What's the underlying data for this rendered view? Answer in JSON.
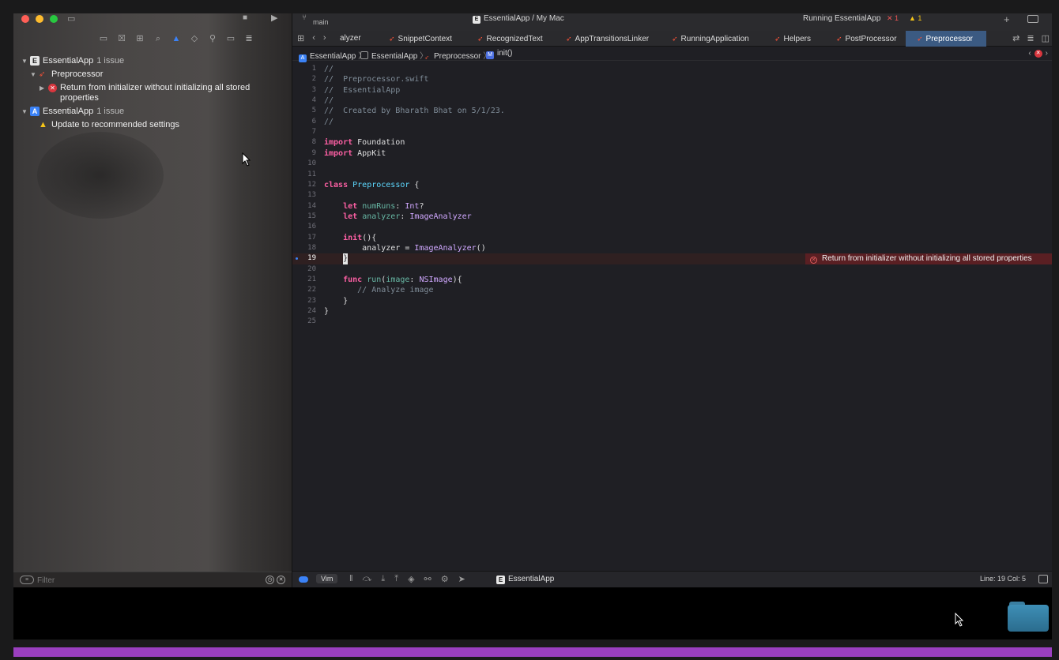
{
  "window": {
    "traffic_colors": [
      "#ff5f57",
      "#febc2e",
      "#28c840"
    ]
  },
  "titlebar": {
    "branch": "main",
    "scheme": "EssentialApp / My Mac",
    "status": "Running EssentialApp",
    "error_count": "1",
    "warning_count": "1"
  },
  "tabs": [
    {
      "label": "alyzer"
    },
    {
      "label": "SnippetContext"
    },
    {
      "label": "RecognizedText"
    },
    {
      "label": "AppTransitionsLinker"
    },
    {
      "label": "RunningApplication"
    },
    {
      "label": "Helpers"
    },
    {
      "label": "PostProcessor"
    },
    {
      "label": "Preprocessor",
      "active": true
    }
  ],
  "jumpbar": {
    "project": "EssentialApp",
    "folder": "EssentialApp",
    "file": "Preprocessor",
    "symbol_badge": "M",
    "symbol": "init()"
  },
  "issues": {
    "group1": {
      "title": "EssentialApp",
      "count": "1 issue"
    },
    "file": "Preprocessor",
    "error_message": "Return from initializer without initializing all stored properties",
    "group2": {
      "title": "EssentialApp",
      "count": "1 issue"
    },
    "warning_message": "Update to recommended settings"
  },
  "filter": {
    "placeholder": "Filter"
  },
  "code": {
    "lines": [
      "//",
      "//  Preprocessor.swift",
      "//  EssentialApp",
      "//",
      "//  Created by Bharath Bhat on 5/1/23.",
      "//",
      "",
      "import Foundation",
      "import AppKit",
      "",
      "",
      "class Preprocessor {",
      "",
      "    let numRuns: Int?",
      "    let analyzer: ImageAnalyzer",
      "",
      "    init(){",
      "        analyzer = ImageAnalyzer()",
      "    }",
      "",
      "    func run(image: NSImage){",
      "       // Analyze image",
      "    }",
      "}",
      ""
    ],
    "current_line": 19,
    "inline_error": "Return from initializer without initializing all stored properties"
  },
  "statusbar": {
    "mode": "Vim",
    "target": "EssentialApp",
    "position": "Line: 19  Col: 5"
  },
  "colors": {
    "accent": "#3b82f6",
    "error": "#d9363e",
    "warning": "#f5c518",
    "swift": "#f05138",
    "purple_bar": "#9a3fc0"
  }
}
